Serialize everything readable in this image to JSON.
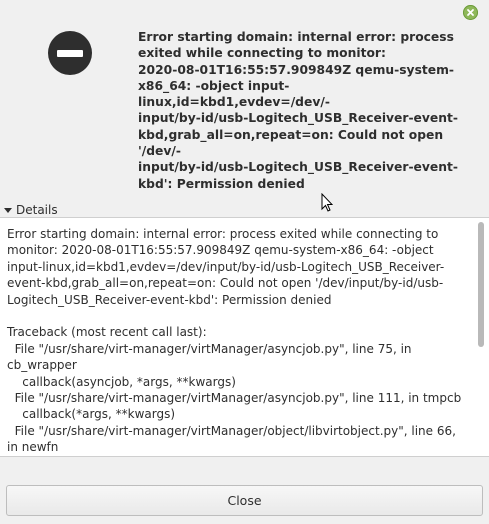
{
  "dialog": {
    "primary_message": "Error starting domain: internal error: process\nexited while connecting to monitor:\n2020-08-01T16:55:57.909849Z qemu-system-\nx86_64: -object input-linux,id=kbd1,evdev=/dev/-\ninput/by-id/usb-Logitech_USB_Receiver-event-\nkbd,grab_all=on,repeat=on: Could not open '/dev/-\ninput/by-id/usb-Logitech_USB_Receiver-event-\nkbd': Permission denied",
    "icon": "error-icon",
    "titlebar_close_icon": "close-icon"
  },
  "details": {
    "label": "Details",
    "expanded": true,
    "text": "Error starting domain: internal error: process exited while connecting to\nmonitor: 2020-08-01T16:55:57.909849Z qemu-system-x86_64: -object\ninput-linux,id=kbd1,evdev=/dev/input/by-id/usb-Logitech_USB_Receiver-\nevent-kbd,grab_all=on,repeat=on: Could not open '/dev/input/by-id/usb-\nLogitech_USB_Receiver-event-kbd': Permission denied\n\nTraceback (most recent call last):\n  File \"/usr/share/virt-manager/virtManager/asyncjob.py\", line 75, in\ncb_wrapper\n    callback(asyncjob, *args, **kwargs)\n  File \"/usr/share/virt-manager/virtManager/asyncjob.py\", line 111, in tmpcb\n    callback(*args, **kwargs)\n  File \"/usr/share/virt-manager/virtManager/object/libvirtobject.py\", line 66,\nin newfn"
  },
  "buttons": {
    "close_label": "Close"
  },
  "colors": {
    "titlebar_close": "#8fb85a",
    "background": "#f0f0f0",
    "details_background": "#ffffff"
  }
}
